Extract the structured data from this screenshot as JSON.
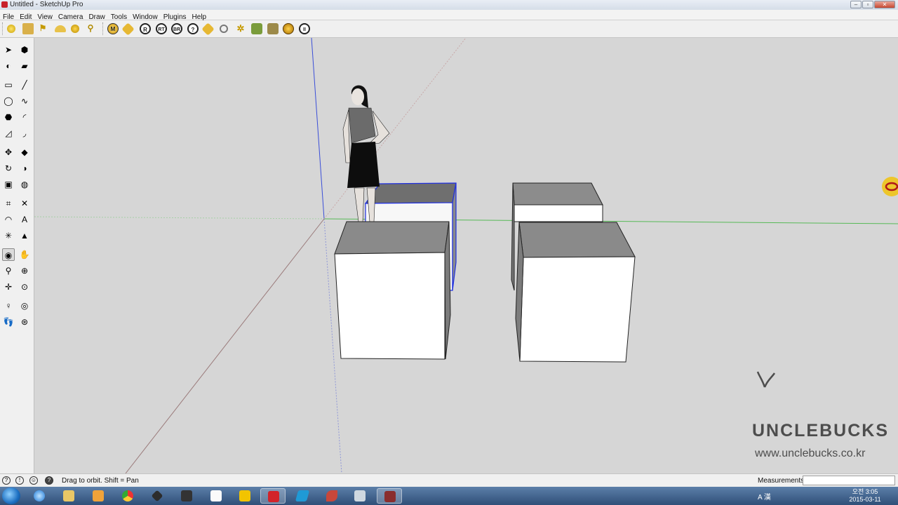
{
  "window": {
    "title": "Untitled - SketchUp Pro",
    "controls": [
      "minimize-icon",
      "maximize-icon",
      "close-icon"
    ]
  },
  "menu": [
    "File",
    "Edit",
    "View",
    "Camera",
    "Draw",
    "Tools",
    "Window",
    "Plugins",
    "Help"
  ],
  "toolbar": {
    "icons": [
      {
        "name": "sphere-icon",
        "label": ""
      },
      {
        "name": "push-pull-icon",
        "label": ""
      },
      {
        "name": "arrow-flag-icon",
        "label": ""
      },
      {
        "name": "hemisphere-icon",
        "label": ""
      },
      {
        "name": "dome-icon",
        "label": ""
      },
      {
        "name": "pin-icon",
        "label": ""
      },
      {
        "name": "plugin-m-icon",
        "label": "M"
      },
      {
        "name": "tag-icon",
        "label": ""
      },
      {
        "name": "plugin-r-icon",
        "label": "R"
      },
      {
        "name": "plugin-rt-icon",
        "label": "RT"
      },
      {
        "name": "plugin-br-icon",
        "label": "BR"
      },
      {
        "name": "plugin-help-icon",
        "label": "?"
      },
      {
        "name": "paint-tag-icon",
        "label": ""
      },
      {
        "name": "target-icon",
        "label": ""
      },
      {
        "name": "flash-icon",
        "label": ""
      },
      {
        "name": "tree-icon",
        "label": ""
      },
      {
        "name": "wizard-icon",
        "label": ""
      },
      {
        "name": "gold-coin-icon",
        "label": ""
      },
      {
        "name": "pause-icon",
        "label": "II"
      }
    ]
  },
  "palette": [
    {
      "name": "select-tool-icon",
      "glyph": "➤"
    },
    {
      "name": "make-component-icon",
      "glyph": "⬢"
    },
    {
      "name": "paint-bucket-icon",
      "glyph": "◐"
    },
    {
      "name": "eraser-icon",
      "glyph": "▰"
    },
    {
      "name": "rectangle-tool-icon",
      "glyph": "▭"
    },
    {
      "name": "line-tool-icon",
      "glyph": "╱"
    },
    {
      "name": "circle-tool-icon",
      "glyph": "◯"
    },
    {
      "name": "freehand-icon",
      "glyph": "∿"
    },
    {
      "name": "polygon-tool-icon",
      "glyph": "⬣"
    },
    {
      "name": "arc-tool-icon",
      "glyph": "◜"
    },
    {
      "name": "rotated-rectangle-icon",
      "glyph": "◿"
    },
    {
      "name": "two-point-arc-icon",
      "glyph": "◞"
    },
    {
      "name": "move-tool-icon",
      "glyph": "✥"
    },
    {
      "name": "push-pull-tool-icon",
      "glyph": "◆"
    },
    {
      "name": "rotate-tool-icon",
      "glyph": "↻"
    },
    {
      "name": "follow-me-icon",
      "glyph": "◑"
    },
    {
      "name": "scale-tool-icon",
      "glyph": "▣"
    },
    {
      "name": "offset-tool-icon",
      "glyph": "◍"
    },
    {
      "name": "tape-measure-icon",
      "glyph": "⌗"
    },
    {
      "name": "dimension-tool-icon",
      "glyph": "✕"
    },
    {
      "name": "protractor-icon",
      "glyph": "◠"
    },
    {
      "name": "text-tool-icon",
      "glyph": "A"
    },
    {
      "name": "axes-tool-icon",
      "glyph": "✳"
    },
    {
      "name": "3d-text-icon",
      "glyph": "▲"
    },
    {
      "name": "orbit-tool-icon",
      "glyph": "◉"
    },
    {
      "name": "pan-tool-icon",
      "glyph": "✋"
    },
    {
      "name": "zoom-tool-icon",
      "glyph": "⚲"
    },
    {
      "name": "zoom-window-icon",
      "glyph": "⊕"
    },
    {
      "name": "zoom-extents-icon",
      "glyph": "✛"
    },
    {
      "name": "previous-view-icon",
      "glyph": "⊙"
    },
    {
      "name": "position-camera-icon",
      "glyph": "♀"
    },
    {
      "name": "look-around-icon",
      "glyph": "◎"
    },
    {
      "name": "walk-tool-icon",
      "glyph": "👣"
    },
    {
      "name": "section-plane-icon",
      "glyph": "⊛"
    }
  ],
  "status": {
    "hint": "Drag to orbit.  Shift = Pan",
    "measurements_label": "Measurements",
    "measurements_value": ""
  },
  "watermark": {
    "brand": "UNCLEBUCKS",
    "url": "www.unclebucks.co.kr"
  },
  "taskbar": {
    "apps": [
      "start-orb-icon",
      "internet-explorer-icon",
      "file-explorer-icon",
      "media-player-icon",
      "chrome-icon",
      "sketchup-layout-icon",
      "music-app-icon",
      "photo-app-icon",
      "m-app-icon",
      "red-app-icon",
      "vector-app-icon",
      "shapes-app-icon",
      "notepad-app-icon",
      "sketchup-app-icon"
    ],
    "clock_time": "오전 3:05",
    "clock_date": "2015-03-11",
    "tray": "A 漢"
  },
  "colors": {
    "viewport_bg": "#d6d6d6",
    "box_top": "#8a8a8a",
    "box_front": "#ffffff",
    "box_side": "#7d7d7d",
    "selection_blue": "#1f2fe0",
    "axis_green": "#5cb85c"
  }
}
